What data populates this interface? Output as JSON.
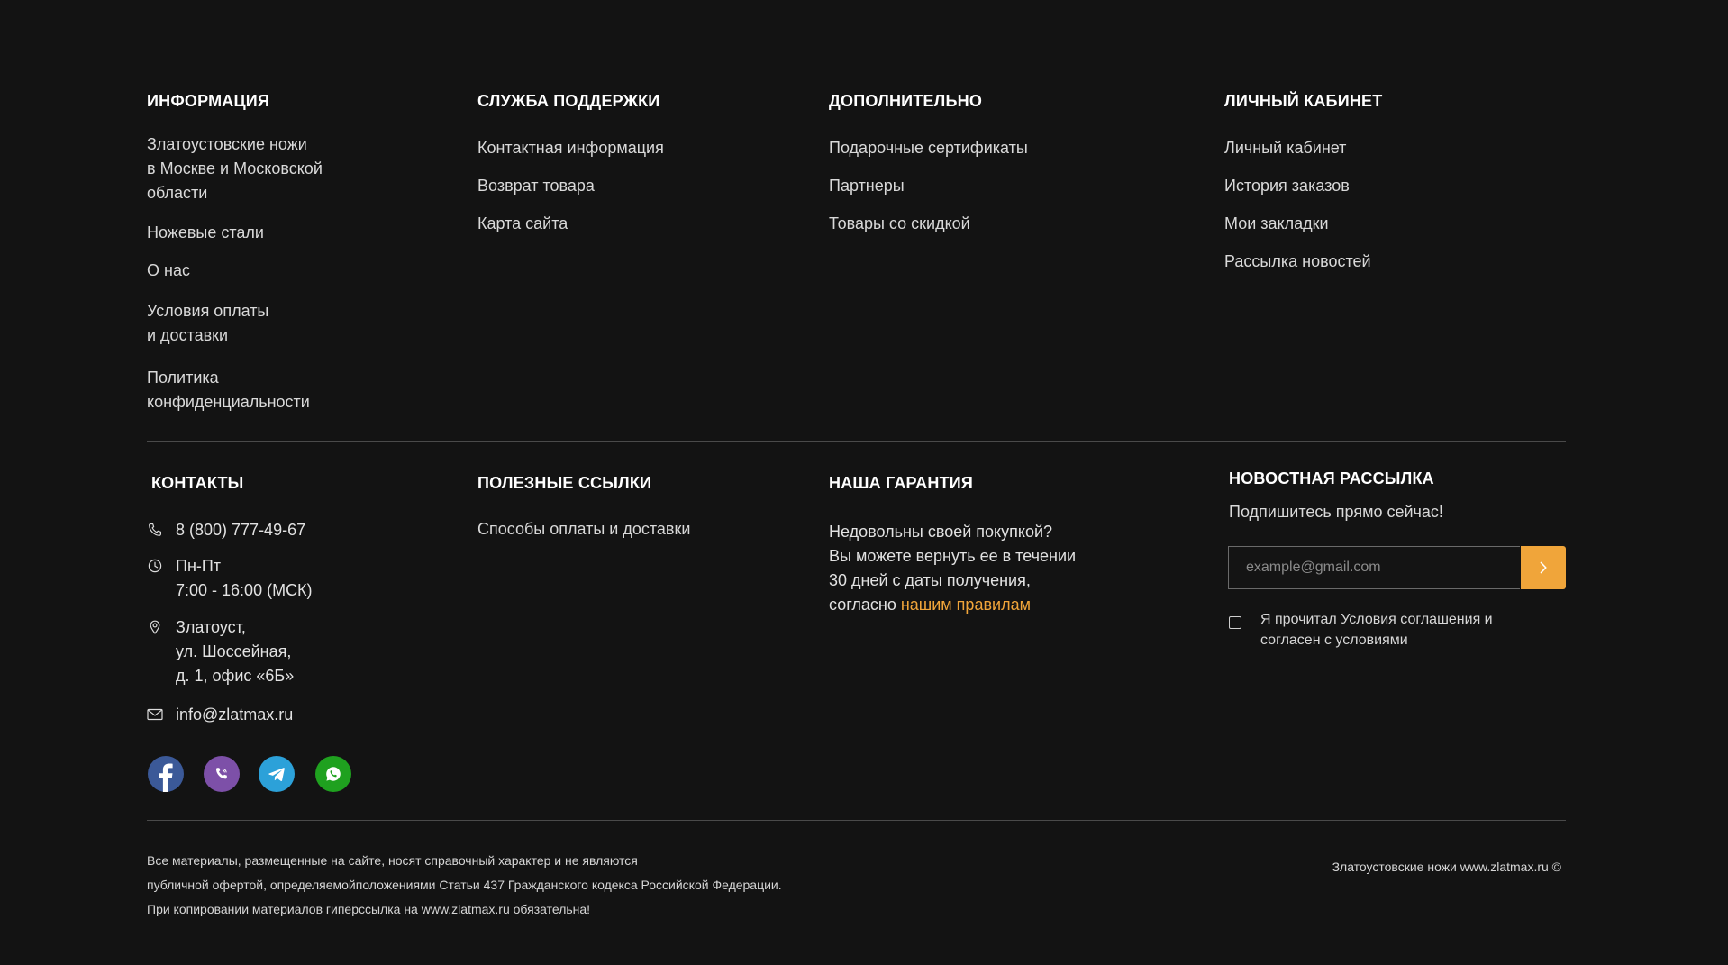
{
  "info": {
    "heading": "ИНФОРМАЦИЯ",
    "items": [
      {
        "lines": [
          "Златоустовские ножи",
          "в Москве и Московской",
          "области"
        ]
      },
      {
        "lines": [
          "Ножевые стали"
        ]
      },
      {
        "lines": [
          "О нас"
        ]
      },
      {
        "lines": [
          "Условия оплаты",
          "и доставки"
        ]
      },
      {
        "lines": [
          "Политика",
          "конфиденциальности"
        ]
      }
    ]
  },
  "support": {
    "heading": "СЛУЖБА ПОДДЕРЖКИ",
    "items": [
      "Контактная информация",
      "Возврат товара",
      "Карта сайта"
    ]
  },
  "extra": {
    "heading": "ДОПОЛНИТЕЛЬНО",
    "items": [
      "Подарочные сертификаты",
      "Партнеры",
      "Товары со скидкой"
    ]
  },
  "account": {
    "heading": "ЛИЧНЫЙ КАБИНЕТ",
    "items": [
      "Личный кабинет",
      "История заказов",
      "Мои закладки",
      "Рассылка новостей"
    ]
  },
  "contacts": {
    "heading": "КОНТАКТЫ",
    "phone": "8 (800) 777-49-67",
    "hours": [
      "Пн-Пт",
      "7:00 - 16:00 (МСК)"
    ],
    "address": [
      "Златоуст,",
      "ул. Шоссейная,",
      "д. 1, офис «6Б»"
    ],
    "email": "info@zlatmax.ru",
    "socials": [
      {
        "icon": "facebook-icon",
        "color": "#3b5998"
      },
      {
        "icon": "viber-icon",
        "color": "#7d50a8"
      },
      {
        "icon": "telegram-icon",
        "color": "#2ca1d9"
      },
      {
        "icon": "whatsapp-icon",
        "color": "#1fa11f"
      }
    ]
  },
  "useful": {
    "heading": "ПОЛЕЗНЫЕ ССЫЛКИ",
    "items": [
      "Способы оплаты и доставки"
    ]
  },
  "guarantee": {
    "heading": "НАША ГАРАНТИЯ",
    "lines": [
      "Недовольны своей покупкой?",
      "Вы можете вернуть ее в течении",
      "30 дней с даты получения,"
    ],
    "last_prefix": "согласно ",
    "rules_link": "нашим правилам"
  },
  "newsletter": {
    "heading": "НОВОСТНАЯ РАССЫЛКА",
    "subtitle": "Подпишитесь прямо сейчас!",
    "placeholder": "example@gmail.com",
    "consent_lines": [
      "Я прочитал Условия соглашения и",
      "согласен с условиями"
    ]
  },
  "legal": {
    "lines": [
      "Все материалы, размещенные на сайте, носят справочный характер и не являются",
      "публичной офертой, определяемойположениями Статьи 437 Гражданского кодекса Российской Федерации.",
      "При копировании материалов гиперссылка на www.zlatmax.ru обязательна!"
    ],
    "copyright": "Златоустовские ножи www.zlatmax.ru ©"
  },
  "colors": {
    "background": "#131313",
    "accent": "#f0a53a",
    "divider": "#4a4a4a"
  }
}
